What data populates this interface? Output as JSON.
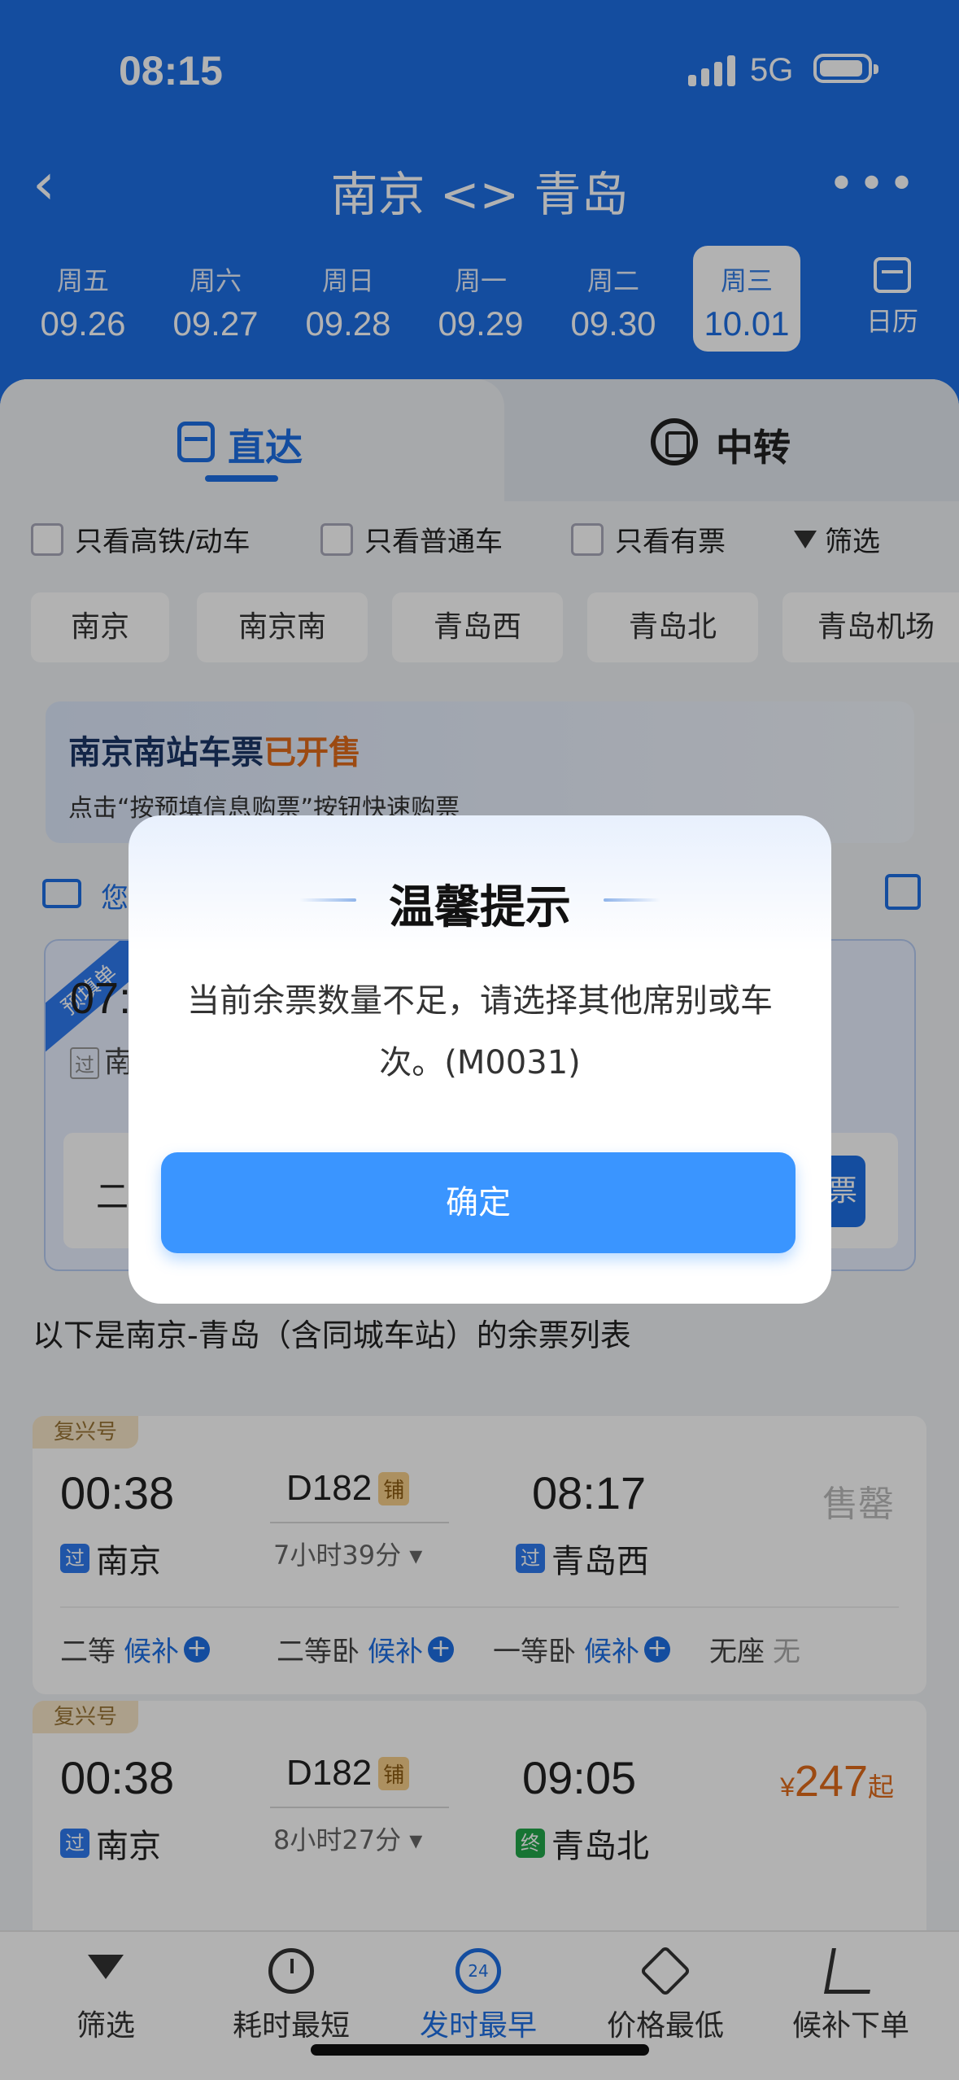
{
  "status_bar": {
    "time": "08:15",
    "network": "5G"
  },
  "nav": {
    "title": "南京 <> 青岛",
    "back_icon": "chevron-left-icon",
    "more_icon": "more-dots-icon"
  },
  "dates": [
    {
      "weekday": "周五",
      "date": "09.26"
    },
    {
      "weekday": "周六",
      "date": "09.27"
    },
    {
      "weekday": "周日",
      "date": "09.28"
    },
    {
      "weekday": "周一",
      "date": "09.29"
    },
    {
      "weekday": "周二",
      "date": "09.30"
    },
    {
      "weekday": "周三",
      "date": "10.01",
      "selected": true
    }
  ],
  "calendar_label": "日历",
  "tabs": {
    "direct": "直达",
    "transfer": "中转"
  },
  "filters": [
    "只看高铁/动车",
    "只看普通车",
    "只看有票"
  ],
  "filter_button": "筛选",
  "stations": [
    "南京",
    "南京南",
    "青岛西",
    "青岛北",
    "青岛机场"
  ],
  "banner": {
    "title_prefix": "南京南站车票",
    "title_highlight": "已开售",
    "subtitle": "点击“按预填信息购票”按钮快速购票"
  },
  "user_line": "您",
  "prefill": {
    "ribbon": "预填单",
    "time": "07:",
    "pass_tag": "过",
    "station": "南",
    "seat": "二",
    "button": "票"
  },
  "list_title": "以下是南京-青岛（含同城车站）的余票列表",
  "trains": [
    {
      "brand": "复兴号",
      "dep_time": "00:38",
      "dep_station": "南京",
      "dep_tag": "过",
      "code": "D182",
      "sleeper_tag": "铺",
      "duration": "7小时39分",
      "arr_time": "08:17",
      "arr_station": "青岛西",
      "arr_tag": "过",
      "status": "售罄",
      "seats": [
        {
          "type": "二等",
          "value": "候补",
          "plus": true
        },
        {
          "type": "二等卧",
          "value": "候补",
          "plus": true
        },
        {
          "type": "一等卧",
          "value": "候补",
          "plus": true
        },
        {
          "type": "无座",
          "value": "无",
          "plus": false
        }
      ]
    },
    {
      "brand": "复兴号",
      "dep_time": "00:38",
      "dep_station": "南京",
      "dep_tag": "过",
      "code": "D182",
      "sleeper_tag": "铺",
      "duration": "8小时27分",
      "arr_time": "09:05",
      "arr_station": "青岛北",
      "arr_tag": "终",
      "price_symbol": "¥",
      "price": "247",
      "price_suffix": "起"
    }
  ],
  "tabbar": [
    {
      "label": "筛选",
      "icon": "funnel-icon"
    },
    {
      "label": "耗时最短",
      "icon": "clock-icon"
    },
    {
      "label": "发时最早",
      "icon": "24h-icon",
      "active": true
    },
    {
      "label": "价格最低",
      "icon": "price-tag-icon"
    },
    {
      "label": "候补下单",
      "icon": "cart-icon"
    }
  ],
  "dialog": {
    "title": "温馨提示",
    "message": "当前余票数量不足，请选择其他席别或车次。(M0031)",
    "ok": "确定"
  },
  "colors": {
    "primary": "#1d6fe4",
    "dialog_button": "#3a95ff",
    "price": "#e06a1b"
  }
}
